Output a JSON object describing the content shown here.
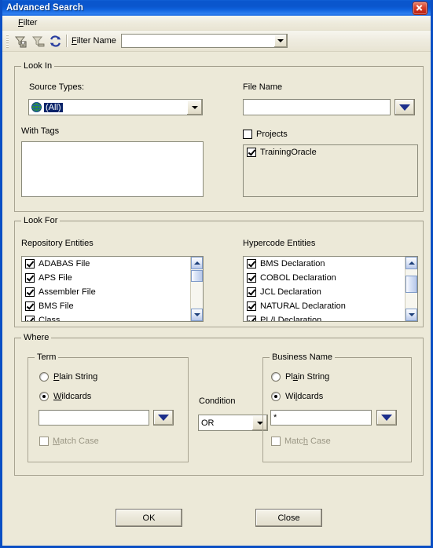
{
  "window": {
    "title": "Advanced Search",
    "close_icon": "close-icon"
  },
  "menubar": {
    "items": [
      {
        "label": "Filter",
        "accel": "F"
      }
    ]
  },
  "toolbar": {
    "buttons": [
      {
        "name": "save-filter-icon",
        "tooltip": "Save Filter"
      },
      {
        "name": "delete-filter-icon",
        "tooltip": "Delete Filter"
      },
      {
        "name": "refresh-icon",
        "tooltip": "Refresh"
      }
    ],
    "filter_name_label": "Filter Name",
    "filter_name_accel": "F",
    "filter_name_value": "",
    "filter_name_placeholder": ""
  },
  "look_in": {
    "legend": "Look In",
    "source_types_label": "Source Types:",
    "source_types_value": "(All)",
    "source_types_icon": "globe-icon",
    "with_tags_label": "With Tags",
    "with_tags_items": [],
    "file_name_label": "File Name",
    "file_name_value": "",
    "file_name_dropdown_icon": "chevron-down-icon",
    "projects_label": "Projects",
    "projects_checked": false,
    "projects_items": [
      {
        "label": "TrainingOracle",
        "checked": true
      }
    ]
  },
  "look_for": {
    "legend": "Look For",
    "repository_label": "Repository Entities",
    "repository_items": [
      {
        "label": "ADABAS File",
        "checked": true
      },
      {
        "label": "APS File",
        "checked": true
      },
      {
        "label": "Assembler File",
        "checked": true
      },
      {
        "label": "BMS File",
        "checked": true
      },
      {
        "label": "Class",
        "checked": true
      }
    ],
    "hypercode_label": "Hypercode Entities",
    "hypercode_items": [
      {
        "label": "BMS Declaration",
        "checked": true
      },
      {
        "label": "COBOL Declaration",
        "checked": true
      },
      {
        "label": "JCL Declaration",
        "checked": true
      },
      {
        "label": "NATURAL Declaration",
        "checked": true
      },
      {
        "label": "PL/I Declaration",
        "checked": true
      }
    ]
  },
  "where": {
    "legend": "Where",
    "term": {
      "legend": "Term",
      "plain_string_label": "Plain String",
      "plain_string_accel": "P",
      "wildcards_label": "Wildcards",
      "wildcards_accel": "W",
      "selected": "Wildcards",
      "value": "",
      "dropdown_icon": "chevron-down-icon",
      "match_case_label": "Match Case",
      "match_case_accel": "M",
      "match_case_checked": false,
      "match_case_enabled": false
    },
    "condition": {
      "label": "Condition",
      "value": "OR"
    },
    "business_name": {
      "legend": "Business Name",
      "plain_string_label": "Plain String",
      "plain_string_accel": "a",
      "wildcards_label": "Wildcards",
      "wildcards_accel": "l",
      "selected": "Wildcards",
      "value": "*",
      "dropdown_icon": "chevron-down-icon",
      "match_case_label": "Match Case",
      "match_case_accel": "h",
      "match_case_checked": false,
      "match_case_enabled": false
    }
  },
  "footer": {
    "ok_label": "OK",
    "close_label": "Close"
  },
  "colors": {
    "dialog_bg": "#ece9d8",
    "title_blue": "#0a56cd",
    "window_border": "#0a4fc4",
    "selection_blue": "#0a246a",
    "close_red": "#c2301c",
    "arrow_navy": "#1d2f8c"
  }
}
